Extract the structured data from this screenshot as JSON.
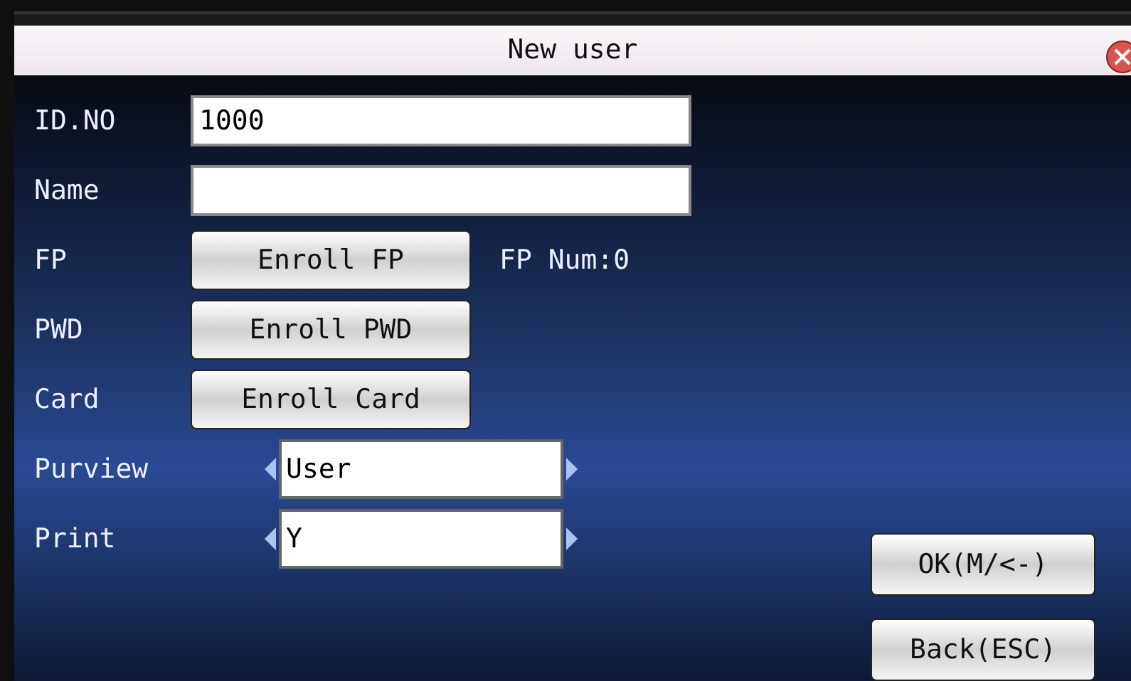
{
  "window": {
    "title": "New user"
  },
  "fields": [
    {
      "label": "ID.NO",
      "kind": "input",
      "value": "1000"
    },
    {
      "label": "Name",
      "kind": "input"
    },
    {
      "label": "FP",
      "kind": "button",
      "button": "Enroll FP",
      "note": "FP Num:0"
    },
    {
      "label": "PWD",
      "kind": "button",
      "button": "Enroll PWD"
    },
    {
      "label": "Card",
      "kind": "button",
      "button": "Enroll Card"
    },
    {
      "label": "Purview",
      "kind": "select",
      "value": "User"
    },
    {
      "label": "Print",
      "kind": "select",
      "value": "Y"
    }
  ],
  "buttons": [
    "OK(M/<-)",
    "Back(ESC)"
  ]
}
